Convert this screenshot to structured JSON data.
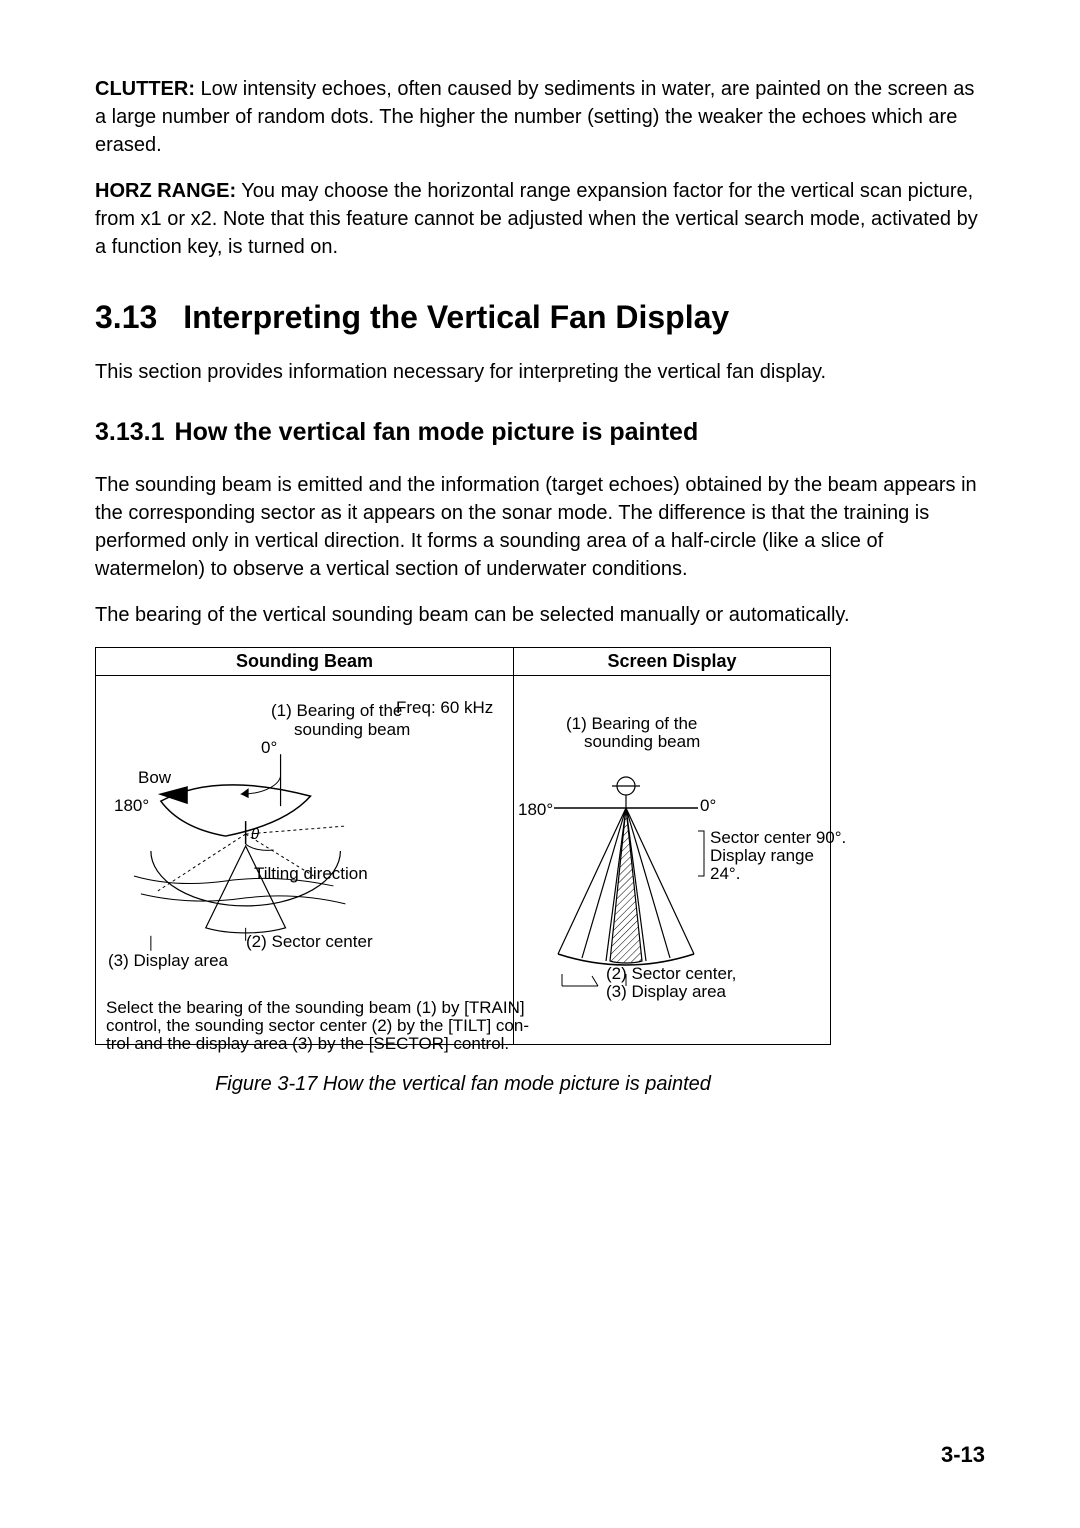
{
  "body": {
    "clutter": {
      "lead": "CLUTTER:",
      "text": " Low intensity echoes, often caused by sediments in water, are painted on the screen as a large number of random dots. The higher the number (setting) the weaker the echoes which are erased."
    },
    "horz": {
      "lead": "HORZ RANGE:",
      "text": " You may choose the horizontal range expansion factor for the vertical scan picture, from x1 or x2. Note that this feature cannot be adjusted when the vertical search mode, activated by a function key, is turned on."
    }
  },
  "section": {
    "num": "3.13",
    "title": "Interpreting the Vertical Fan Display",
    "intro": "This section provides information necessary for interpreting the vertical fan display."
  },
  "subsection": {
    "num": "3.13.1",
    "title": "How the vertical fan mode picture is painted",
    "p1": "The sounding beam is emitted and the information (target echoes) obtained by the beam appears in the corresponding sector as it appears on the sonar mode. The difference is that the training is performed only in vertical direction. It forms a sounding area of a half-circle (like a slice of watermelon) to observe a vertical section of underwater conditions.",
    "p2": "The bearing of the vertical sounding beam can be selected manually or automatically."
  },
  "figure": {
    "header": {
      "left": "Sounding Beam",
      "right": "Screen Display"
    },
    "left": {
      "freq": "Freq: 60 kHz",
      "bearing1": "(1) Bearing of the",
      "bearing2": "sounding beam",
      "zero": "0°",
      "bow": "Bow",
      "a180": "180°",
      "tilt": "Tilting direction",
      "sector": "(2) Sector center",
      "display": "(3) Display area",
      "theta": "θ",
      "note1": "Select the bearing of the sounding beam (1) by [TRAIN]",
      "note2": "control, the sounding sector center (2) by the [TILT] con-",
      "note3": "trol and the display area (3) by the [SECTOR] control."
    },
    "right": {
      "bearing1": "(1) Bearing of the",
      "bearing2": "sounding beam",
      "a180": "180°",
      "zero": "0°",
      "sc1": "Sector center 90°.",
      "sc2": "Display range",
      "sc3": "24°.",
      "note1": "(2) Sector center,",
      "note2": "(3) Display area"
    },
    "caption": "Figure 3-17 How the vertical fan mode picture is painted"
  },
  "pagenum": "3-13"
}
